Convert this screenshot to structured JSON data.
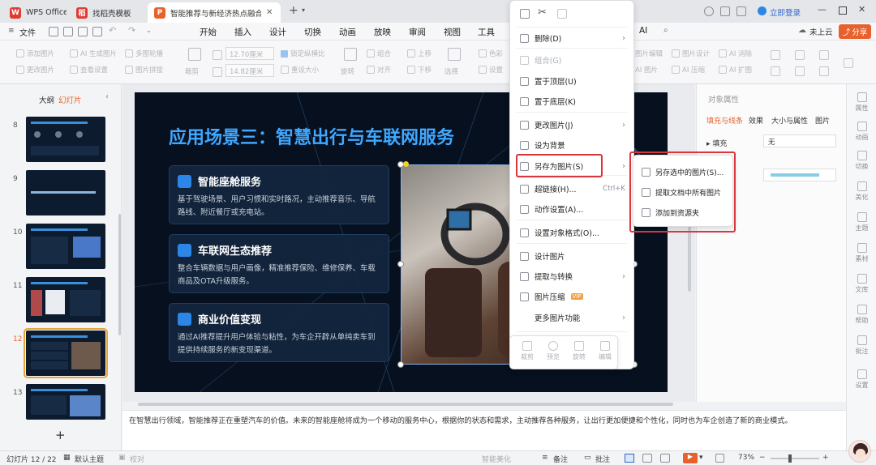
{
  "tabs": [
    {
      "label": "WPS Office",
      "logo": "W",
      "logo_color": "#e03c31"
    },
    {
      "label": "找稻壳模板",
      "logo": "稻",
      "logo_color": "#e03c31"
    },
    {
      "label": "智能推荐与新经济热点融合PPT",
      "logo": "P",
      "logo_color": "#e8612c"
    }
  ],
  "menubar": {
    "file": "文件",
    "tabs": [
      "开始",
      "插入",
      "设计",
      "切换",
      "动画",
      "放映",
      "审阅",
      "视图",
      "工具"
    ],
    "partial_ai": "AI",
    "cloud": "未上云",
    "share": "分享",
    "login": "立即登录"
  },
  "ribbon": {
    "add_image": "添加图片",
    "ai_image": "AI 生成图片",
    "multi_carousel": "多图轮播",
    "change_image": "更改图片",
    "view_settings": "查看设置",
    "image_stitch": "图片拼接",
    "crop": "裁剪",
    "width": "12.70厘米",
    "height": "14.82厘米",
    "lock_ratio": "锁定纵横比",
    "reset_size": "重设大小",
    "rotate": "旋转",
    "group": "组合",
    "align": "对齐",
    "up": "上移",
    "down": "下移",
    "select": "选择",
    "color": "色彩",
    "settings": "设置",
    "image_edit": "图片编辑",
    "image_design": "图片设计",
    "ai_remove": "AI 消除",
    "ai_image2": "AI 图片",
    "ai_compress": "AI 压缩",
    "ai_expand": "AI 扩图"
  },
  "left_panel": {
    "outline_tab": "大纲",
    "slides_tab": "幻灯片",
    "slide_numbers": [
      "8",
      "9",
      "10",
      "11",
      "12",
      "13"
    ],
    "active_slide": "12",
    "add": "+"
  },
  "slide": {
    "title": "应用场景三：智慧出行与车联网服务",
    "cards": [
      {
        "title": "智能座舱服务",
        "body": "基于驾驶场景、用户习惯和实时路况，主动推荐音乐、导航路线、附近餐厅或充电站。"
      },
      {
        "title": "车联网生态推荐",
        "body": "整合车辆数据与用户画像，精准推荐保险、维修保养、车载商品及OTA升级服务。"
      },
      {
        "title": "商业价值变现",
        "body": "通过AI推荐提升用户体验与粘性，为车企开辟从单纯卖车到提供持续服务的新变现渠道。"
      }
    ]
  },
  "context_menu": {
    "items": [
      {
        "label": "删除(D)",
        "icon": "trash-icon",
        "arrow": true,
        "disabled": false
      },
      {
        "label": "组合(G)",
        "icon": "group-icon",
        "arrow": false,
        "disabled": true
      },
      {
        "label": "置于顶层(U)",
        "icon": "bring-front-icon",
        "arrow": false,
        "disabled": false
      },
      {
        "label": "置于底层(K)",
        "icon": "send-back-icon",
        "arrow": false,
        "disabled": false
      },
      {
        "label": "更改图片(J)",
        "icon": "change-image-icon",
        "arrow": true,
        "disabled": false
      },
      {
        "label": "设为背景",
        "icon": "background-icon",
        "arrow": false,
        "disabled": false
      },
      {
        "label": "另存为图片(S)",
        "icon": "save-image-icon",
        "arrow": true,
        "disabled": false
      },
      {
        "label": "超链接(H)...",
        "icon": "link-icon",
        "arrow": false,
        "disabled": false,
        "shortcut": "Ctrl+K"
      },
      {
        "label": "动作设置(A)...",
        "icon": "action-icon",
        "arrow": false,
        "disabled": false
      },
      {
        "label": "设置对象格式(O)...",
        "icon": "format-icon",
        "arrow": false,
        "disabled": false
      },
      {
        "label": "设计图片",
        "icon": "design-icon",
        "arrow": false,
        "disabled": false
      },
      {
        "label": "提取与转换",
        "icon": "extract-icon",
        "arrow": true,
        "disabled": false
      },
      {
        "label": "图片压缩",
        "icon": "compress-icon",
        "arrow": false,
        "disabled": false,
        "badge": "VIP"
      },
      {
        "label": "更多图片功能",
        "icon": "",
        "arrow": true,
        "disabled": false
      }
    ],
    "mini_toolbar": [
      "裁剪",
      "预览",
      "旋转",
      "编辑"
    ]
  },
  "submenu": {
    "items": [
      "另存选中的图片(S)...",
      "提取文档中所有图片",
      "添加到资源夹"
    ]
  },
  "right_panel": {
    "title": "对象属性",
    "tabs": [
      "填充与线条",
      "效果",
      "大小与属性",
      "图片"
    ],
    "fill_label": "填充",
    "fill_value": "无"
  },
  "right_bar": [
    "属性",
    "动画",
    "切换",
    "美化",
    "主题",
    "素材",
    "文库",
    "帮助",
    "批注",
    "设置"
  ],
  "notes": "在智慧出行领域，智能推荐正在重塑汽车的价值。未来的智能座舱将成为一个移动的服务中心，根据你的状态和需求，主动推荐各种服务，让出行更加便捷和个性化，同时也为车企创造了新的商业模式。",
  "status": {
    "slide": "幻灯片 12 / 22",
    "theme": "默认主题",
    "proofread": "校对",
    "beautify": "智能美化",
    "notes_btn": "备注",
    "comment": "批注",
    "zoom": "73%"
  },
  "colors": {
    "accent": "#2b86e8",
    "share": "#e8612c",
    "highlight": "#d9363e"
  }
}
